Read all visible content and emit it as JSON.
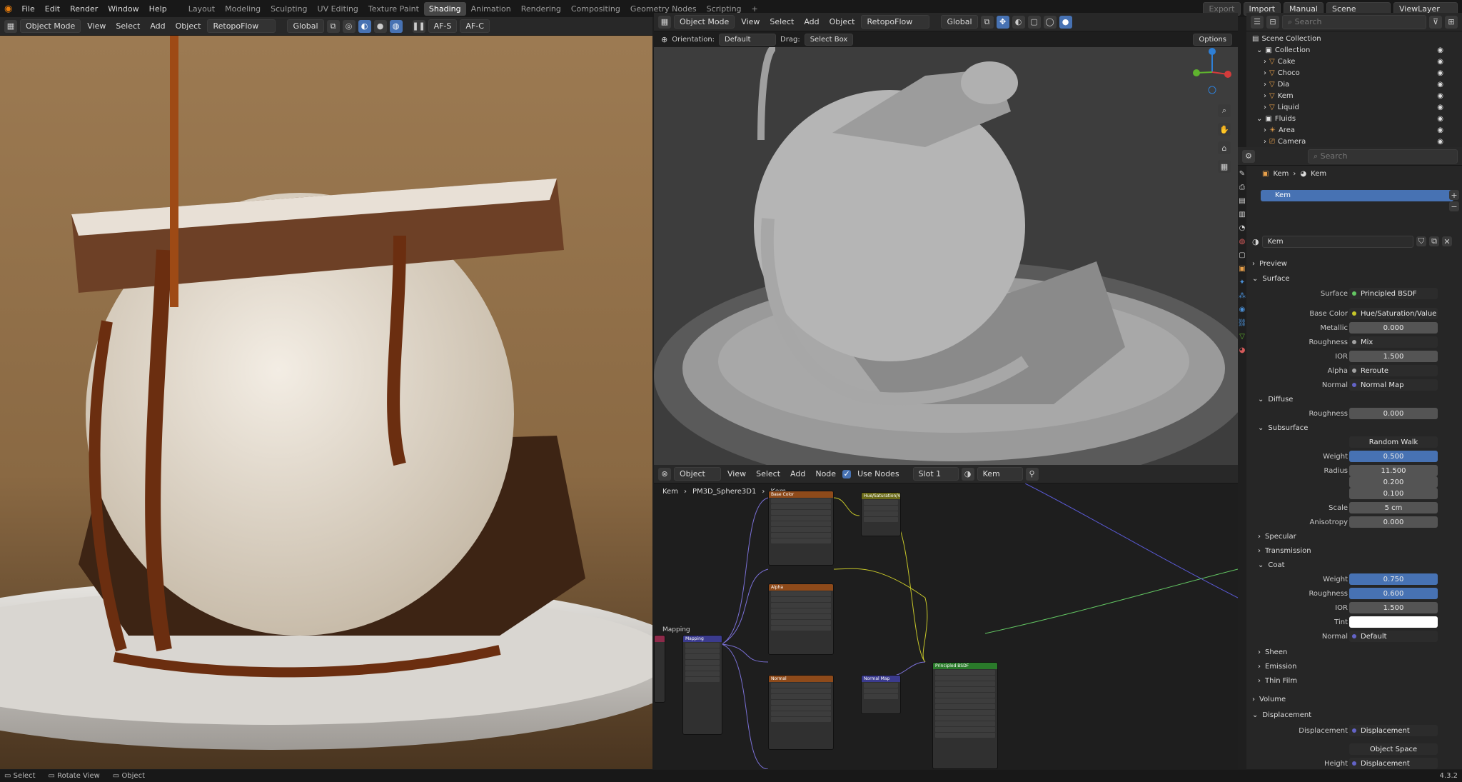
{
  "topbar": {
    "menus": [
      "File",
      "Edit",
      "Render",
      "Window",
      "Help"
    ],
    "workspaces": [
      "Layout",
      "Modeling",
      "Sculpting",
      "UV Editing",
      "Texture Paint",
      "Shading",
      "Animation",
      "Rendering",
      "Compositing",
      "Geometry Nodes",
      "Scripting"
    ],
    "active_workspace": "Shading",
    "export": "Export",
    "import": "Import",
    "manual": "Manual",
    "scene": "Scene",
    "view_layer": "ViewLayer"
  },
  "left_header": {
    "mode": "Object Mode",
    "view": "View",
    "select": "Select",
    "add": "Add",
    "object": "Object",
    "addon": "RetopoFlow",
    "transform": "Global",
    "af_s": "AF-S",
    "af_c": "AF-C"
  },
  "viewport": {
    "mode": "Object Mode",
    "view": "View",
    "select": "Select",
    "add": "Add",
    "object": "Object",
    "addon": "RetopoFlow",
    "transform": "Global",
    "orientation_label": "Orientation:",
    "orientation": "Default",
    "drag_label": "Drag:",
    "drag": "Select Box",
    "options": "Options"
  },
  "node_editor": {
    "type": "Object",
    "view": "View",
    "select": "Select",
    "add": "Add",
    "node": "Node",
    "use_nodes": "Use Nodes",
    "slot": "Slot 1",
    "material": "Kem",
    "breadcrumb": [
      "Kem",
      "PM3D_Sphere3D1",
      "Kem"
    ],
    "frame_label": "Mapping",
    "nodes": {
      "hue": "Hue/Saturation/Value",
      "base": "Base Color",
      "alpha": "Alpha",
      "normal": "Normal",
      "mapping": "Mapping",
      "normal_map": "Normal Map",
      "principled": "Principled BSDF"
    }
  },
  "outliner": {
    "search_placeholder": "Search",
    "root": "Scene Collection",
    "items": [
      {
        "label": "Collection",
        "level": 1
      },
      {
        "label": "Cake",
        "level": 2
      },
      {
        "label": "Choco",
        "level": 2
      },
      {
        "label": "Dia",
        "level": 2
      },
      {
        "label": "Kem",
        "level": 2
      },
      {
        "label": "Liquid",
        "level": 2
      },
      {
        "label": "Fluids",
        "level": 1
      },
      {
        "label": "Area",
        "level": 2
      },
      {
        "label": "Camera",
        "level": 2
      }
    ]
  },
  "properties": {
    "search_placeholder": "Search",
    "breadcrumb_obj": "Kem",
    "breadcrumb_mat": "Kem",
    "slot_name": "Kem",
    "material_name": "Kem",
    "sections": {
      "preview": "Preview",
      "surface": "Surface",
      "diffuse": "Diffuse",
      "subsurface": "Subsurface",
      "specular": "Specular",
      "transmission": "Transmission",
      "coat": "Coat",
      "sheen": "Sheen",
      "emission": "Emission",
      "thin_film": "Thin Film",
      "volume": "Volume",
      "displacement": "Displacement"
    },
    "rows": [
      {
        "label": "Surface",
        "value": "Principled BSDF",
        "kind": "dark",
        "dot": "#63c763"
      },
      {
        "label": "Base Color",
        "value": "Hue/Saturation/Value",
        "kind": "dark",
        "dot": "#c7c729"
      },
      {
        "label": "Metallic",
        "value": "0.000",
        "kind": "num",
        "dot": "#a1a1a1"
      },
      {
        "label": "Roughness",
        "value": "Mix",
        "kind": "dark",
        "dot": "#a1a1a1"
      },
      {
        "label": "IOR",
        "value": "1.500",
        "kind": "num",
        "dot": "#a1a1a1"
      },
      {
        "label": "Alpha",
        "value": "Reroute",
        "kind": "dark",
        "dot": "#a1a1a1"
      },
      {
        "label": "Normal",
        "value": "Normal Map",
        "kind": "dark",
        "dot": "#6363c7"
      },
      {
        "label": "Roughness",
        "value": "0.000",
        "kind": "num",
        "dot": "#a1a1a1"
      },
      {
        "label": "",
        "value": "Random Walk",
        "kind": "dark",
        "dot": ""
      },
      {
        "label": "Weight",
        "value": "0.500",
        "kind": "blue",
        "dot": "#a1a1a1"
      },
      {
        "label": "Radius",
        "value": "11.500",
        "kind": "num",
        "dot": "#6363c7"
      },
      {
        "label": "",
        "value": "0.200",
        "kind": "num",
        "dot": ""
      },
      {
        "label": "",
        "value": "0.100",
        "kind": "num",
        "dot": ""
      },
      {
        "label": "Scale",
        "value": "5 cm",
        "kind": "num",
        "dot": "#a1a1a1"
      },
      {
        "label": "Anisotropy",
        "value": "0.000",
        "kind": "num",
        "dot": "#a1a1a1"
      },
      {
        "label": "Weight",
        "value": "0.750",
        "kind": "blue",
        "dot": "#a1a1a1"
      },
      {
        "label": "Roughness",
        "value": "0.600",
        "kind": "blue",
        "dot": "#a1a1a1"
      },
      {
        "label": "IOR",
        "value": "1.500",
        "kind": "num",
        "dot": "#a1a1a1"
      },
      {
        "label": "Tint",
        "value": "",
        "kind": "white",
        "dot": "#c7c729"
      },
      {
        "label": "Normal",
        "value": "Default",
        "kind": "dark",
        "dot": "#6363c7"
      },
      {
        "label": "Displacement",
        "value": "Displacement",
        "kind": "dark",
        "dot": "#6363c7"
      },
      {
        "label": "",
        "value": "Object Space",
        "kind": "dark",
        "dot": ""
      },
      {
        "label": "Height",
        "value": "Displacement",
        "kind": "dark",
        "dot": "#6363c7"
      }
    ]
  },
  "status": {
    "select": "Select",
    "rotate": "Rotate View",
    "object": "Object",
    "version": "4.3.2"
  }
}
